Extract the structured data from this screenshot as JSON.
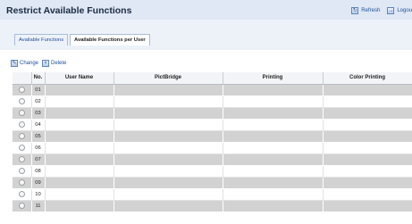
{
  "header": {
    "title": "Restrict Available Functions",
    "refresh_label": "Refresh",
    "logout_label": "Logou"
  },
  "tabs": [
    {
      "label": "Available Functions",
      "active": true
    },
    {
      "label": "Available Functions per User",
      "active": false
    }
  ],
  "toolbar": {
    "change_label": "Change",
    "delete_label": "Delete"
  },
  "table": {
    "columns": [
      "No.",
      "User Name",
      "PictBridge",
      "Printing",
      "Color Printing"
    ],
    "rows": [
      {
        "no": "01",
        "user_name": ""
      },
      {
        "no": "02",
        "user_name": ""
      },
      {
        "no": "03",
        "user_name": ""
      },
      {
        "no": "04",
        "user_name": ""
      },
      {
        "no": "05",
        "user_name": ""
      },
      {
        "no": "06",
        "user_name": ""
      },
      {
        "no": "07",
        "user_name": ""
      },
      {
        "no": "08",
        "user_name": ""
      },
      {
        "no": "09",
        "user_name": ""
      },
      {
        "no": "10",
        "user_name": ""
      },
      {
        "no": "11",
        "user_name": ""
      }
    ]
  },
  "colors": {
    "header_bar": "#dfe8f4",
    "link": "#1f4f9a",
    "row_alt": "#d2d2d2"
  },
  "icons": {
    "refresh": "refresh-icon",
    "logout": "logout-icon",
    "change": "change-icon",
    "delete": "delete-icon"
  }
}
